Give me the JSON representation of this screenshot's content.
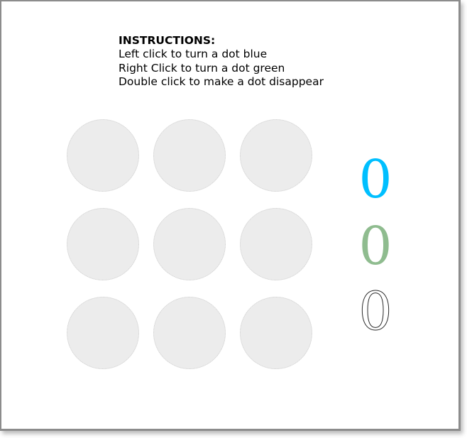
{
  "instructions": {
    "heading": "INSTRUCTIONS:",
    "lines": [
      "Left click to turn a dot blue",
      "Right Click to turn a dot green",
      "Double click to make a dot disappear"
    ]
  },
  "dots": [
    {
      "state": "gray"
    },
    {
      "state": "gray"
    },
    {
      "state": "gray"
    },
    {
      "state": "gray"
    },
    {
      "state": "gray"
    },
    {
      "state": "gray"
    },
    {
      "state": "gray"
    },
    {
      "state": "gray"
    },
    {
      "state": "gray"
    }
  ],
  "counters": {
    "blue": {
      "value": "0",
      "color": "#00bfff"
    },
    "green": {
      "value": "0",
      "color": "#8fbc8f"
    },
    "disappeared": {
      "value": "0",
      "color": "#ffffff",
      "stroke": "#2a2a2a"
    }
  },
  "colors": {
    "dot_default": "#ececec",
    "dot_border": "#cfcfcf",
    "frame_border": "#8c8c8c"
  }
}
